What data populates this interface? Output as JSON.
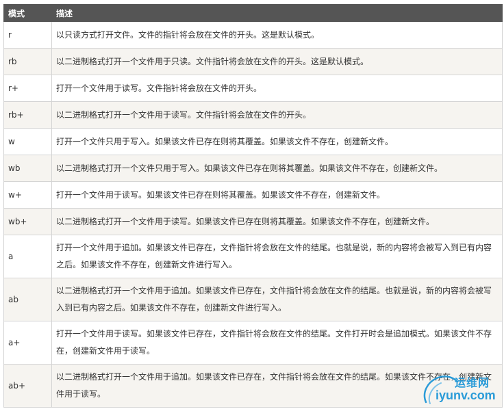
{
  "table": {
    "headers": [
      "模式",
      "描述"
    ],
    "rows": [
      {
        "mode": "r",
        "desc": "以只读方式打开文件。文件的指针将会放在文件的开头。这是默认模式。"
      },
      {
        "mode": "rb",
        "desc": "以二进制格式打开一个文件用于只读。文件指针将会放在文件的开头。这是默认模式。"
      },
      {
        "mode": "r+",
        "desc": "打开一个文件用于读写。文件指针将会放在文件的开头。"
      },
      {
        "mode": "rb+",
        "desc": "以二进制格式打开一个文件用于读写。文件指针将会放在文件的开头。"
      },
      {
        "mode": "w",
        "desc": "打开一个文件只用于写入。如果该文件已存在则将其覆盖。如果该文件不存在，创建新文件。"
      },
      {
        "mode": "wb",
        "desc": "以二进制格式打开一个文件只用于写入。如果该文件已存在则将其覆盖。如果该文件不存在，创建新文件。"
      },
      {
        "mode": "w+",
        "desc": "打开一个文件用于读写。如果该文件已存在则将其覆盖。如果该文件不存在，创建新文件。"
      },
      {
        "mode": "wb+",
        "desc": "以二进制格式打开一个文件用于读写。如果该文件已存在则将其覆盖。如果该文件不存在，创建新文件。"
      },
      {
        "mode": "a",
        "desc": "打开一个文件用于追加。如果该文件已存在，文件指针将会放在文件的结尾。也就是说，新的内容将会被写入到已有内容之后。如果该文件不存在，创建新文件进行写入。"
      },
      {
        "mode": "ab",
        "desc": "以二进制格式打开一个文件用于追加。如果该文件已存在，文件指针将会放在文件的结尾。也就是说，新的内容将会被写入到已有内容之后。如果该文件不存在，创建新文件进行写入。"
      },
      {
        "mode": "a+",
        "desc": "打开一个文件用于读写。如果该文件已存在，文件指针将会放在文件的结尾。文件打开时会是追加模式。如果该文件不存在，创建新文件用于读写。"
      },
      {
        "mode": "ab+",
        "desc": "以二进制格式打开一个文件用于追加。如果该文件已存在，文件指针将会放在文件的结尾。如果该文件不存在，创建新文件用于读写。"
      }
    ]
  },
  "watermark": {
    "name": "运维网",
    "url": "iyunv.com",
    "color": "#2a9bd8"
  },
  "colors": {
    "header_bg": "#555555",
    "header_text": "#ffffff",
    "row_alt_bg": "#f6f4f0",
    "border": "#d4d4d4",
    "text": "#333333"
  }
}
